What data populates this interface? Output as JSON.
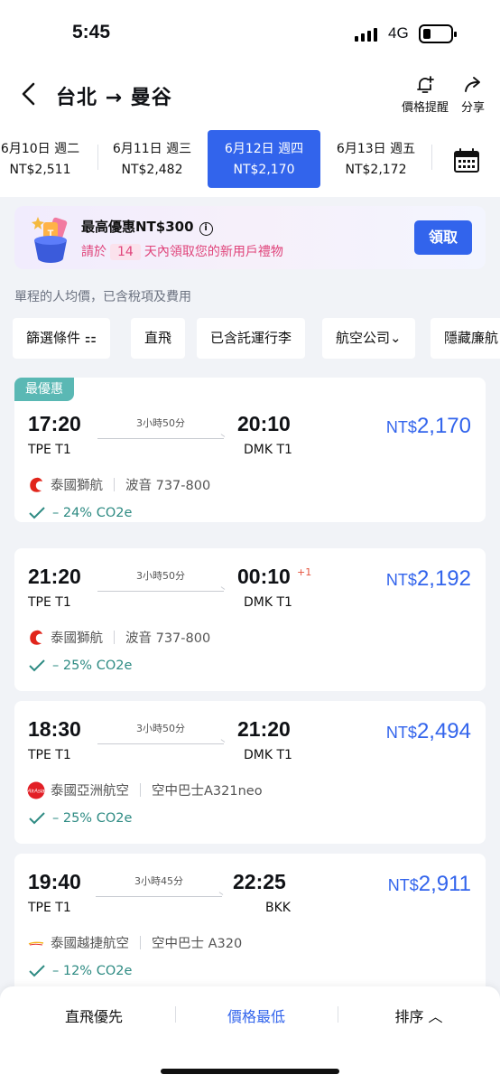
{
  "status_bar": {
    "time": "5:45",
    "network": "4G"
  },
  "header": {
    "title": "台北 → 曼谷",
    "price_alert_label": "價格提醒",
    "share_label": "分享"
  },
  "dates": [
    {
      "date": "6月10日 週二",
      "price": "NT$2,511",
      "active": false
    },
    {
      "date": "6月11日 週三",
      "price": "NT$2,482",
      "active": false
    },
    {
      "date": "6月12日 週四",
      "price": "NT$2,170",
      "active": true
    },
    {
      "date": "6月13日 週五",
      "price": "NT$2,172",
      "active": false
    }
  ],
  "promo": {
    "title": "最高優惠NT$300",
    "info_icon": "i",
    "sub_before": "請於",
    "days": "14",
    "sub_after": "天內領取您的新用戶禮物",
    "claim_label": "領取"
  },
  "price_note": "單程的人均價，已含稅項及費用",
  "filters": [
    "篩選條件 ⚏",
    "直飛",
    "已含託運行李",
    "航空公司⌄",
    "隱藏廉航"
  ],
  "flights": [
    {
      "tag": "最優惠",
      "dep_time": "17:20",
      "dep_code": "TPE T1",
      "duration": "3小時50分",
      "arr_time": "20:10",
      "arr_code": "DMK T1",
      "plus_day": "",
      "currency": "NT$",
      "price": "2,170",
      "airline": "泰國獅航",
      "aircraft": "波音 737-800",
      "logo": "lion-air",
      "co2": "– 24% CO2e"
    },
    {
      "tag": "",
      "dep_time": "21:20",
      "dep_code": "TPE T1",
      "duration": "3小時50分",
      "arr_time": "00:10",
      "arr_code": "DMK T1",
      "plus_day": "+1",
      "currency": "NT$",
      "price": "2,192",
      "airline": "泰國獅航",
      "aircraft": "波音 737-800",
      "logo": "lion-air",
      "co2": "– 25% CO2e"
    },
    {
      "tag": "",
      "dep_time": "18:30",
      "dep_code": "TPE T1",
      "duration": "3小時50分",
      "arr_time": "21:20",
      "arr_code": "DMK T1",
      "plus_day": "",
      "currency": "NT$",
      "price": "2,494",
      "airline": "泰國亞洲航空",
      "aircraft": "空中巴士A321neo",
      "logo": "airasia",
      "co2": "– 25% CO2e"
    },
    {
      "tag": "",
      "dep_time": "19:40",
      "dep_code": "TPE T1",
      "duration": "3小時45分",
      "arr_time": "22:25",
      "arr_code": "BKK",
      "plus_day": "",
      "currency": "NT$",
      "price": "2,911",
      "airline": "泰國越捷航空",
      "aircraft": "空中巴士 A320",
      "logo": "vietjet",
      "co2": "– 12% CO2e"
    }
  ],
  "bottom_bar": {
    "nonstop_first": "直飛優先",
    "lowest_price": "價格最低",
    "sort": "排序 ︿"
  },
  "colors": {
    "accent": "#3264ec",
    "promo_pink": "#e0457b",
    "eco_green": "#2e8b83",
    "best_tag": "#5ab8b4"
  }
}
